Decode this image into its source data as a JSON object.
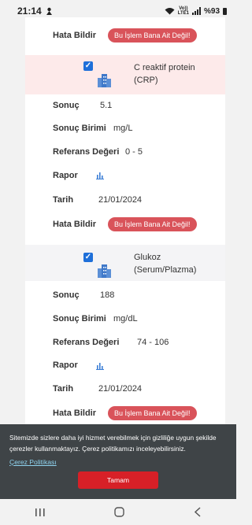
{
  "status_bar": {
    "time": "21:14",
    "volte_line1": "Vo))",
    "volte_line2": "LTE1",
    "battery": "%93"
  },
  "buttons": {
    "not_mine": "Bu İşlem Bana Ait Değil!"
  },
  "labels": {
    "report_owner": "Hata Bildir",
    "result": "Sonuç",
    "unit": "Sonuç Birimi",
    "reference": "Referans Değeri",
    "report": "Rapor",
    "date": "Tarih"
  },
  "tests": [
    {
      "name_line1": "C reaktif protein",
      "name_line2": "(CRP)",
      "result": "5.1",
      "unit": "mg/L",
      "reference": "0 - 5",
      "date": "21/01/2024"
    },
    {
      "name_line1": "Glukoz",
      "name_line2": "(Serum/Plazma)",
      "result": "188",
      "unit": "mg/dL",
      "reference": "74 - 106",
      "date": "21/01/2024"
    }
  ],
  "cookie": {
    "text": "Sitemizde sizlere daha iyi hizmet verebilmek için gizliliğe uygun şekilde çerezler kullanmaktayız. Çerez politikamızı inceleyebilirsiniz.",
    "policy_link": "Çerez Politikası",
    "accept": "Tamam"
  },
  "colors": {
    "accent_red": "#d9535a",
    "checkbox_blue": "#1e6fd9",
    "banner_bg": "#3f4447"
  }
}
